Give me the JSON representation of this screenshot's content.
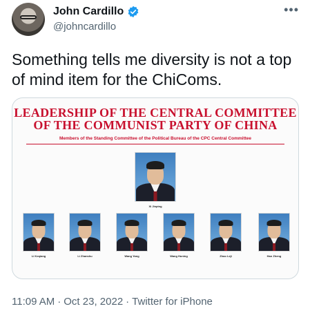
{
  "author": {
    "display_name": "John Cardillo",
    "handle": "@johncardillo"
  },
  "tweet": {
    "text": "Something tells me diversity is not a top of mind item for the ChiComs."
  },
  "media": {
    "title_line1": "LEADERSHIP OF THE CENTRAL COMMITTEE",
    "title_line2": "OF THE COMMUNIST PARTY OF CHINA",
    "subtitle": "Members of the Standing Committee of the Political Bureau of the CPC Central Committee",
    "leader": {
      "name": "Xi Jinping"
    },
    "members": [
      {
        "name": "Li Keqiang"
      },
      {
        "name": "Li Zhanshu"
      },
      {
        "name": "Wang Yang"
      },
      {
        "name": "Wang Huning"
      },
      {
        "name": "Zhao Leji"
      },
      {
        "name": "Han Zheng"
      }
    ]
  },
  "meta": {
    "time": "11:09 AM",
    "separator": "·",
    "date": "Oct 23, 2022",
    "source": "Twitter for iPhone"
  },
  "colors": {
    "verified": "#1d9bf0",
    "poster_red": "#c8102e",
    "secondary_text": "#536471"
  }
}
